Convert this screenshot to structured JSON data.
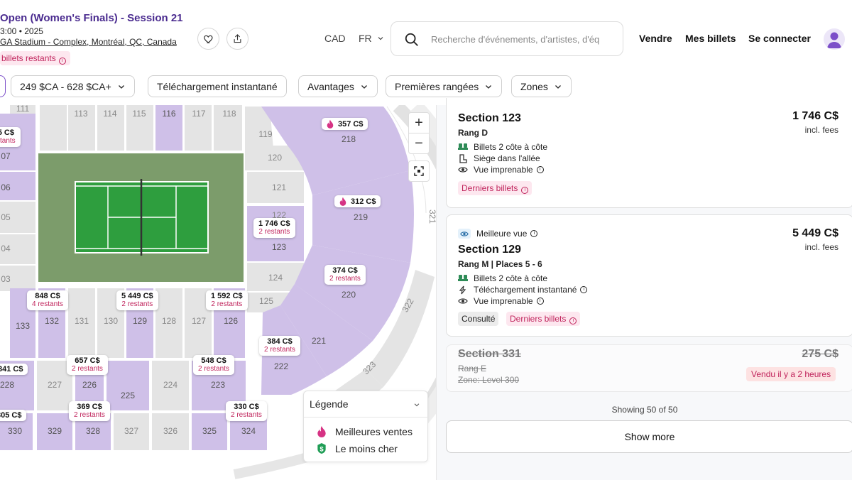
{
  "event": {
    "title": "Open (Women's Finals) - Session 21",
    "date": "3:00 • 2025",
    "venue": "GA Stadium - Complex, Montréal, QC, Canada",
    "remaining": "billets restants"
  },
  "header": {
    "currency": "CAD",
    "language": "FR",
    "search_placeholder": "Recherche d'événements, d'artistes, d'éq",
    "nav": [
      "Vendre",
      "Mes billets",
      "Se connecter"
    ]
  },
  "filters": {
    "price": "249 $CA - 628 $CA+",
    "instant": "Téléchargement instantané",
    "perks": "Avantages",
    "front_rows": "Premières rangées",
    "zones": "Zones"
  },
  "map": {
    "sections_purple": [
      "116",
      "218",
      "219",
      "123",
      "220",
      "222",
      "221",
      "132",
      "129",
      "126",
      "133",
      "226",
      "225",
      "223",
      "224",
      "328",
      "329",
      "330",
      "325",
      "324",
      "107",
      "106",
      "228"
    ],
    "sections_grey": [
      "111",
      "113",
      "114",
      "115",
      "117",
      "118",
      "119",
      "120",
      "121",
      "124",
      "125",
      "131",
      "130",
      "128",
      "127",
      "227",
      "327",
      "326",
      "105",
      "104",
      "103",
      "321",
      "322",
      "323"
    ],
    "price_tags": [
      {
        "price": "357 C$",
        "hot": true,
        "remaining": ""
      },
      {
        "price": "312 C$",
        "hot": true,
        "remaining": ""
      },
      {
        "price": "1 746 C$",
        "hot": false,
        "remaining": "2 restants"
      },
      {
        "price": "374 C$",
        "hot": false,
        "remaining": "2 restants"
      },
      {
        "price": "384 C$",
        "hot": false,
        "remaining": "2 restants"
      },
      {
        "price": "848 C$",
        "hot": false,
        "remaining": "4 restants"
      },
      {
        "price": "5 449 C$",
        "hot": false,
        "remaining": "2 restants"
      },
      {
        "price": "1 592 C$",
        "hot": false,
        "remaining": "2 restants"
      },
      {
        "price": "657 C$",
        "hot": false,
        "remaining": "2 restants"
      },
      {
        "price": "548 C$",
        "hot": false,
        "remaining": "2 restants"
      },
      {
        "price": "369 C$",
        "hot": false,
        "remaining": "2 restants"
      },
      {
        "price": "330 C$",
        "hot": false,
        "remaining": "2 restants"
      },
      {
        "price": "5 C$",
        "hot": false,
        "remaining": "stants"
      },
      {
        "price": "341 C$",
        "hot": false,
        "remaining": ""
      },
      {
        "price": "305 C$",
        "hot": false,
        "remaining": ""
      }
    ],
    "zoom_in": "+",
    "zoom_out": "−"
  },
  "legend": {
    "title": "Légende",
    "items": [
      "Meilleures ventes",
      "Le moins cher"
    ]
  },
  "listings": [
    {
      "section": "Section 123",
      "row": "Rang D",
      "price": "1 746 C$",
      "fees": "incl. fees",
      "features": [
        "Billets 2 côte à côte",
        "Siège dans l'allée",
        "Vue imprenable"
      ],
      "badges": [
        "Derniers billets"
      ]
    },
    {
      "tag": "Meilleure vue",
      "section": "Section 129",
      "row": "Rang M | Places 5 - 6",
      "price": "5 449 C$",
      "fees": "incl. fees",
      "features": [
        "Billets 2 côte à côte",
        "Téléchargement instantané",
        "Vue imprenable"
      ],
      "badges": [
        "Consulté",
        "Derniers billets"
      ]
    },
    {
      "section": "Section 331",
      "row": "Rang E",
      "zone": "Zone: Level 300",
      "price": "275 C$",
      "sold": "Vendu il y a 2 heures"
    }
  ],
  "showing": "Showing 50 of 50",
  "show_more": "Show more",
  "colors": {
    "purple": "#cfc0e8",
    "grey": "#e4e4e4",
    "court": "#7c9c6b",
    "accent": "#c0245c",
    "brand": "#4a2b8f"
  }
}
